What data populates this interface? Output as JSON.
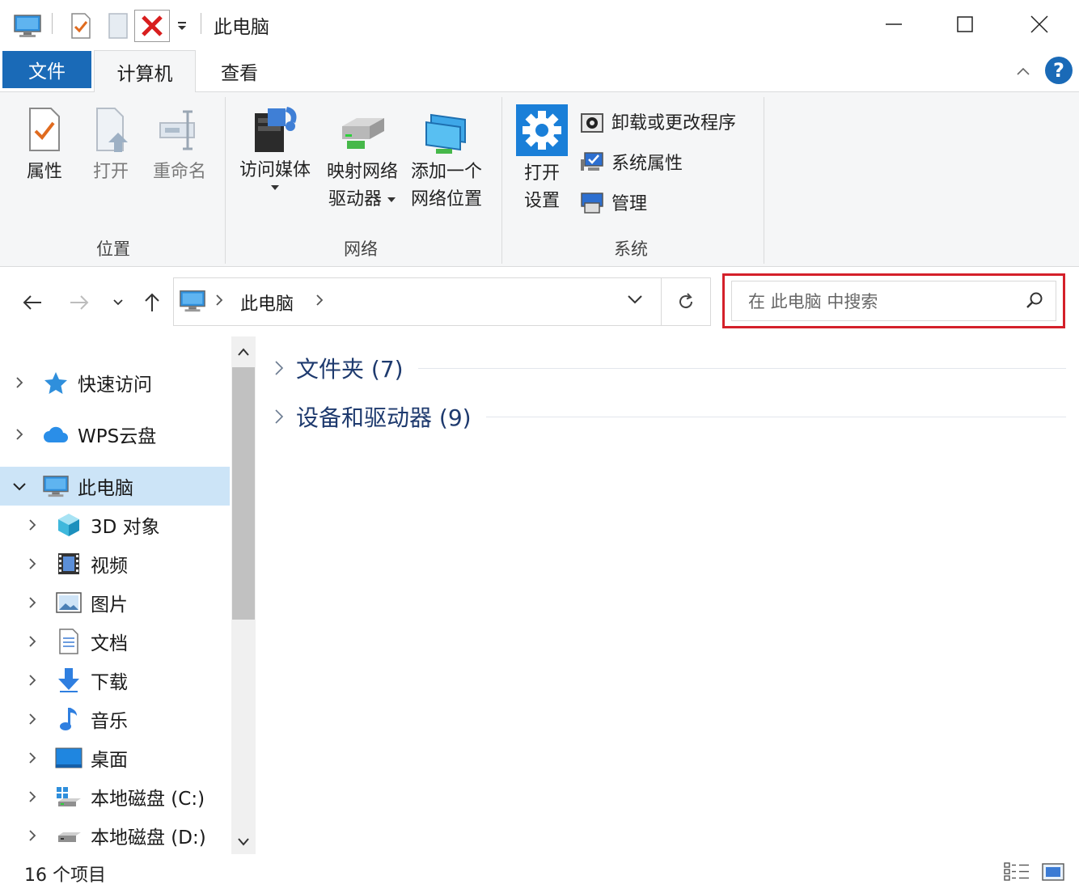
{
  "window": {
    "title": "此电脑"
  },
  "ribbon": {
    "tabs": [
      {
        "label": "文件"
      },
      {
        "label": "计算机"
      },
      {
        "label": "查看"
      }
    ],
    "groups": {
      "location": {
        "label": "位置",
        "buttons": {
          "properties": "属性",
          "open": "打开",
          "rename": "重命名"
        }
      },
      "network": {
        "label": "网络",
        "buttons": {
          "access_media_line1": "访问媒体",
          "map_drive_line1": "映射网络",
          "map_drive_line2": "驱动器",
          "add_location_line1": "添加一个",
          "add_location_line2": "网络位置"
        }
      },
      "system": {
        "label": "系统",
        "buttons": {
          "open_settings_line1": "打开",
          "open_settings_line2": "设置",
          "uninstall": "卸载或更改程序",
          "system_properties": "系统属性",
          "manage": "管理"
        }
      }
    }
  },
  "address": {
    "location": "此电脑"
  },
  "search": {
    "placeholder": "在 此电脑 中搜索"
  },
  "navpane": {
    "items": [
      {
        "label": "快速访问",
        "icon": "star-icon"
      },
      {
        "label": "WPS云盘",
        "icon": "cloud-icon"
      },
      {
        "label": "此电脑",
        "icon": "computer-icon"
      },
      {
        "label": "3D 对象",
        "icon": "cube-icon"
      },
      {
        "label": "视频",
        "icon": "film-icon"
      },
      {
        "label": "图片",
        "icon": "picture-icon"
      },
      {
        "label": "文档",
        "icon": "document-icon"
      },
      {
        "label": "下载",
        "icon": "download-arrow-icon"
      },
      {
        "label": "音乐",
        "icon": "music-note-icon"
      },
      {
        "label": "桌面",
        "icon": "desktop-icon"
      },
      {
        "label": "本地磁盘 (C:)",
        "icon": "drive-c-icon"
      },
      {
        "label": "本地磁盘 (D:)",
        "icon": "drive-icon"
      }
    ]
  },
  "content": {
    "groups": [
      {
        "label": "文件夹 (7)"
      },
      {
        "label": "设备和驱动器 (9)"
      }
    ]
  },
  "status": {
    "item_count": "16 个项目"
  },
  "colors": {
    "accent": "#1a6ab7",
    "selection": "#cce4f7",
    "highlight_border": "#d4202a",
    "group_header": "#1e3a6e"
  }
}
